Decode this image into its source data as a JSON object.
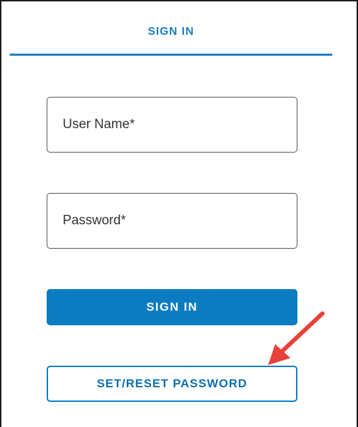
{
  "tab": {
    "label": "SIGN IN",
    "accent_color": "#1a7fc1"
  },
  "form": {
    "username": {
      "value": "",
      "placeholder": "User Name*"
    },
    "password": {
      "value": "",
      "placeholder": "Password*"
    },
    "signin_label": "SIGN IN",
    "reset_label": "SET/RESET PASSWORD"
  },
  "annotation": {
    "icon": "red-arrow-icon",
    "color": "#e8413a"
  },
  "colors": {
    "primary": "#0b7cc1",
    "text": "#333333",
    "border": "#555555"
  }
}
